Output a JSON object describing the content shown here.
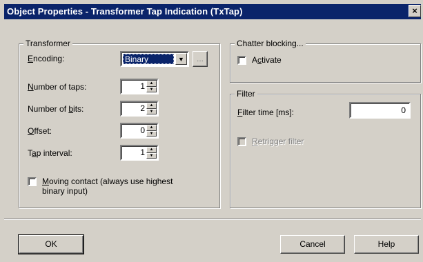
{
  "window": {
    "title": "Object Properties - Transformer Tap Indication (TxTap)",
    "close_label": "×"
  },
  "transformer": {
    "legend": "Transformer",
    "encoding_label_key": "E",
    "encoding_label_rest": "ncoding:",
    "encoding_value": "Binary",
    "browse_label": "...",
    "taps_key": "N",
    "taps_rest": "umber of taps:",
    "taps_value": "1",
    "bits_pre": "Number of ",
    "bits_key": "b",
    "bits_rest": "its:",
    "bits_value": "2",
    "offset_key": "O",
    "offset_rest": "ffset:",
    "offset_value": "0",
    "interval_pre": "T",
    "interval_key": "a",
    "interval_rest": "p interval:",
    "interval_value": "1",
    "moving_key": "M",
    "moving_line1_rest": "oving contact (always use highest",
    "moving_line2": "binary input)",
    "moving_checked": false
  },
  "chatter": {
    "legend": "Chatter blocking...",
    "activate_pre": "A",
    "activate_key": "c",
    "activate_rest": "tivate",
    "activate_checked": false
  },
  "filter": {
    "legend": "Filter",
    "time_key": "F",
    "time_rest": "ilter time [ms]:",
    "time_value": "0",
    "retrigger_key": "R",
    "retrigger_rest": "etrigger filter",
    "retrigger_checked": false
  },
  "buttons": {
    "ok": "OK",
    "cancel": "Cancel",
    "help": "Help"
  }
}
